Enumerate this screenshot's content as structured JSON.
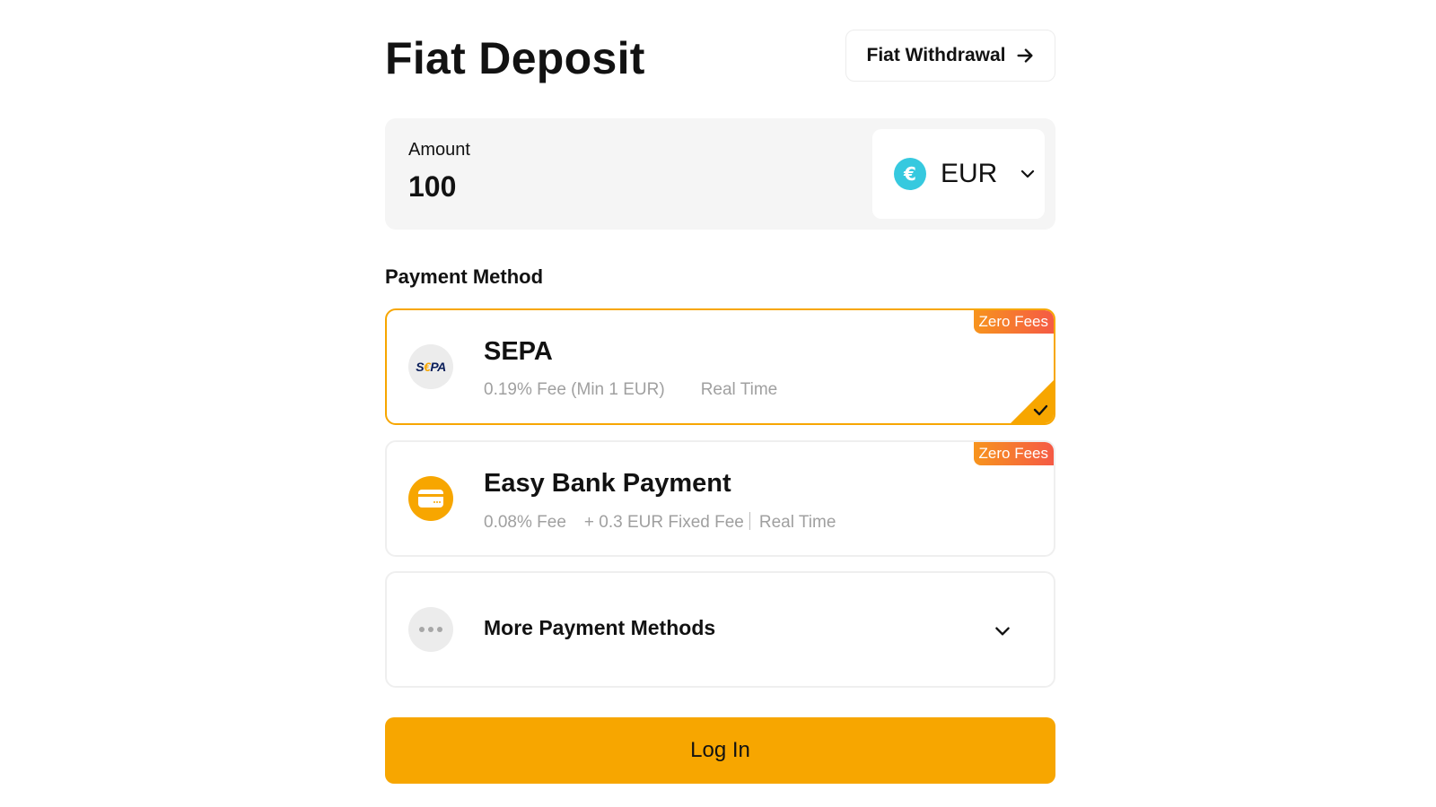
{
  "header": {
    "title": "Fiat Deposit",
    "withdraw_label": "Fiat Withdrawal"
  },
  "amount": {
    "label": "Amount",
    "value": "100",
    "currency": "EUR",
    "currency_symbol": "€"
  },
  "payment": {
    "heading": "Payment Method",
    "methods": [
      {
        "title": "SEPA",
        "fee": "0.19% Fee (Min 1 EUR)",
        "speed": "Real Time",
        "badge": "Zero Fees",
        "selected": true,
        "logo_text": "SEPA",
        "icon": "sepa-logo"
      },
      {
        "title": "Easy Bank Payment",
        "fee": "0.08% Fee",
        "fixed_fee": "+ 0.3 EUR Fixed Fee",
        "speed": "Real Time",
        "badge": "Zero Fees",
        "selected": false,
        "icon": "bank-card-icon"
      }
    ],
    "more_label": "More Payment Methods"
  },
  "login_label": "Log In",
  "colors": {
    "accent": "#f7a600",
    "badge_start": "#f7941d",
    "badge_end": "#f55a45",
    "euro": "#36c9df"
  }
}
